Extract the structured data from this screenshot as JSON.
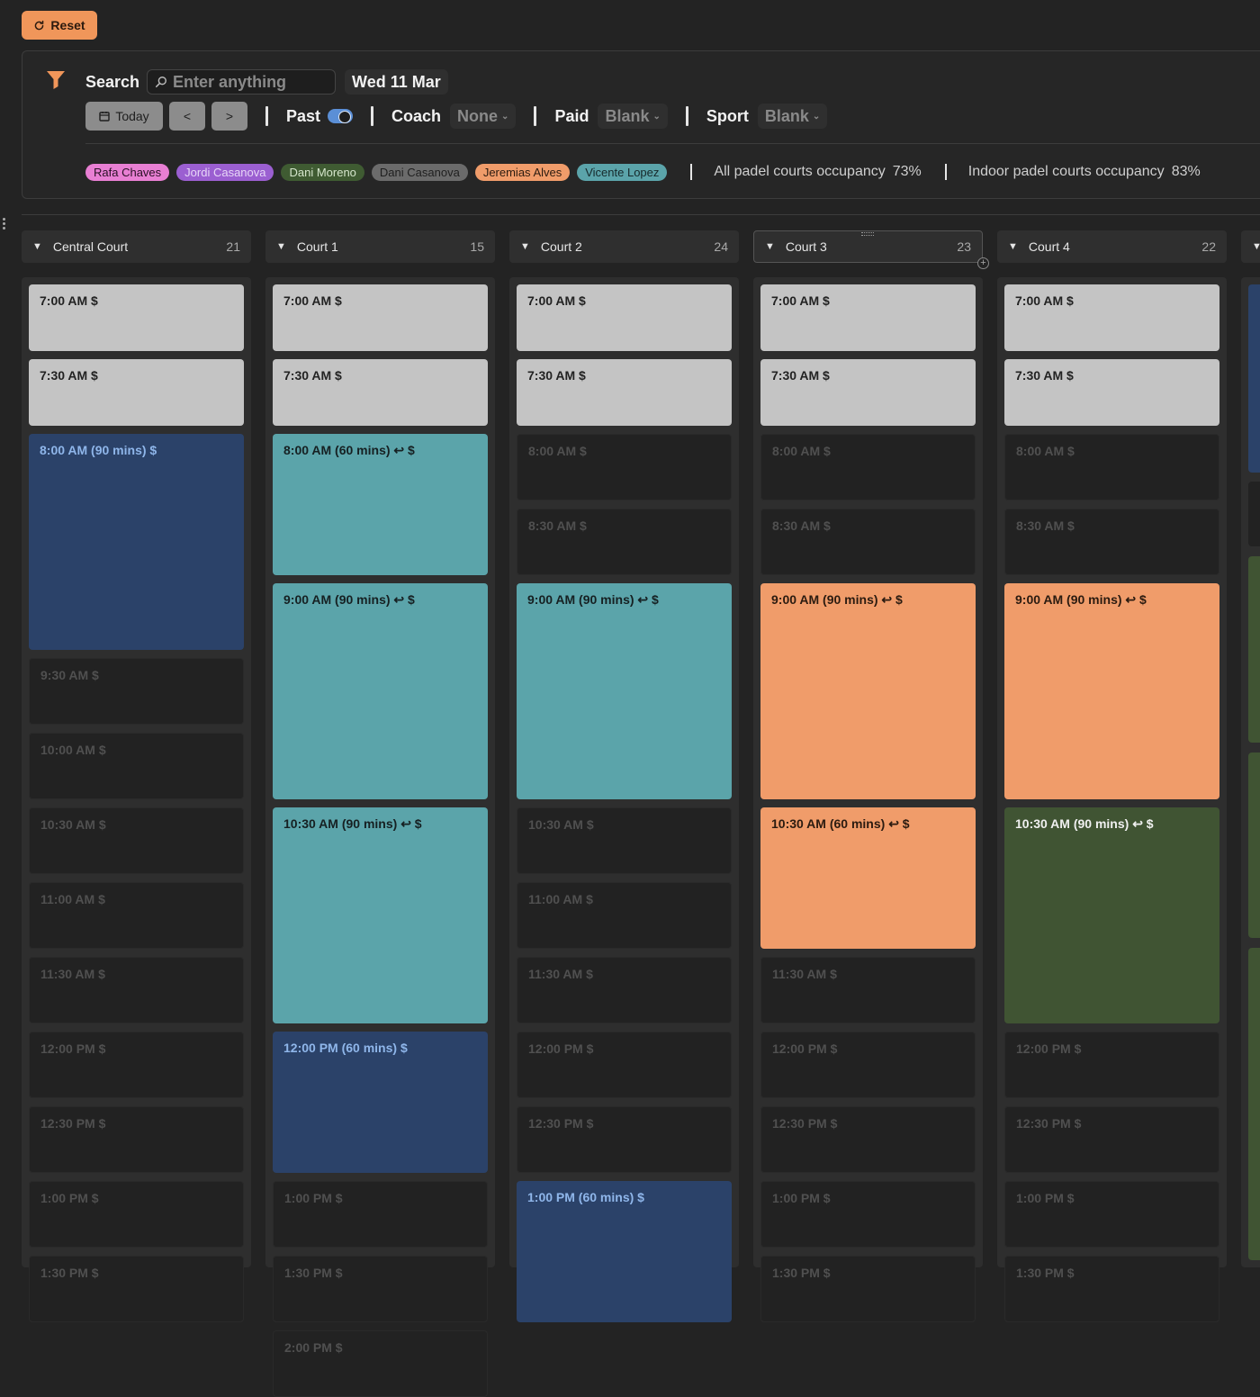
{
  "toolbar": {
    "reset_label": "Reset"
  },
  "filters": {
    "search_label": "Search",
    "search_placeholder": "Enter anything",
    "date": "Wed 11 Mar",
    "today_label": "Today",
    "prev_label": "<",
    "next_label": ">",
    "past_label": "Past",
    "past_enabled": true,
    "coach_label": "Coach",
    "coach_value": "None",
    "paid_label": "Paid",
    "paid_value": "Blank",
    "sport_label": "Sport",
    "sport_value": "Blank"
  },
  "coaches": [
    {
      "name": "Rafa Chaves",
      "bg": "#e87fd3",
      "fg": "#2a1126"
    },
    {
      "name": "Jordi Casanova",
      "bg": "#9b5fd1",
      "fg": "#e7d6f7"
    },
    {
      "name": "Dani Moreno",
      "bg": "#3f5b32",
      "fg": "#d5e6cc"
    },
    {
      "name": "Dani Casanova",
      "bg": "#6b6b6b",
      "fg": "#1f1f1f"
    },
    {
      "name": "Jeremias Alves",
      "bg": "#f09c6a",
      "fg": "#2b1b10"
    },
    {
      "name": "Vicente Lopez",
      "bg": "#5ba4aa",
      "fg": "#16292b"
    }
  ],
  "occupancy": [
    {
      "label": "All padel courts occupancy",
      "value": "73%"
    },
    {
      "label": "Indoor padel courts occupancy",
      "value": "83%"
    }
  ],
  "courts": [
    {
      "name": "Central Court",
      "count": "21",
      "slots": [
        {
          "label": "7:00 AM $",
          "kind": "light",
          "span": 1
        },
        {
          "label": "7:30 AM $",
          "kind": "light",
          "span": 1
        },
        {
          "label": "8:00 AM (90 mins) $",
          "kind": "blue",
          "span": 3
        },
        {
          "label": "9:30 AM $",
          "kind": "empty",
          "span": 1
        },
        {
          "label": "10:00 AM $",
          "kind": "empty",
          "span": 1
        },
        {
          "label": "10:30 AM $",
          "kind": "empty",
          "span": 1
        },
        {
          "label": "11:00 AM $",
          "kind": "empty",
          "span": 1
        },
        {
          "label": "11:30 AM $",
          "kind": "empty",
          "span": 1
        },
        {
          "label": "12:00 PM $",
          "kind": "empty",
          "span": 1
        },
        {
          "label": "12:30 PM $",
          "kind": "empty",
          "span": 1
        },
        {
          "label": "1:00 PM $",
          "kind": "empty",
          "span": 1
        },
        {
          "label": "1:30 PM $",
          "kind": "empty",
          "span": 1
        }
      ]
    },
    {
      "name": "Court 1",
      "count": "15",
      "slots": [
        {
          "label": "7:00 AM $",
          "kind": "light",
          "span": 1
        },
        {
          "label": "7:30 AM $",
          "kind": "light",
          "span": 1
        },
        {
          "label": "8:00 AM (60 mins) ↩ $",
          "kind": "teal",
          "span": 2
        },
        {
          "label": "9:00 AM (90 mins) ↩ $",
          "kind": "teal",
          "span": 3
        },
        {
          "label": "10:30 AM (90 mins) ↩ $",
          "kind": "teal",
          "span": 3
        },
        {
          "label": "12:00 PM (60 mins) $",
          "kind": "blue",
          "span": 2
        },
        {
          "label": "1:00 PM $",
          "kind": "empty",
          "span": 1
        },
        {
          "label": "1:30 PM $",
          "kind": "empty",
          "span": 1
        },
        {
          "label": "2:00 PM $",
          "kind": "empty",
          "span": 1
        }
      ]
    },
    {
      "name": "Court 2",
      "count": "24",
      "slots": [
        {
          "label": "7:00 AM $",
          "kind": "light",
          "span": 1
        },
        {
          "label": "7:30 AM $",
          "kind": "light",
          "span": 1
        },
        {
          "label": "8:00 AM $",
          "kind": "empty",
          "span": 1
        },
        {
          "label": "8:30 AM $",
          "kind": "empty",
          "span": 1
        },
        {
          "label": "9:00 AM (90 mins) ↩ $",
          "kind": "teal",
          "span": 3
        },
        {
          "label": "10:30 AM $",
          "kind": "empty",
          "span": 1
        },
        {
          "label": "11:00 AM $",
          "kind": "empty",
          "span": 1
        },
        {
          "label": "11:30 AM $",
          "kind": "empty",
          "span": 1
        },
        {
          "label": "12:00 PM $",
          "kind": "empty",
          "span": 1
        },
        {
          "label": "12:30 PM $",
          "kind": "empty",
          "span": 1
        },
        {
          "label": "1:00 PM (60 mins) $",
          "kind": "blue",
          "span": 2
        }
      ]
    },
    {
      "name": "Court 3",
      "count": "23",
      "slots": [
        {
          "label": "7:00 AM $",
          "kind": "light",
          "span": 1
        },
        {
          "label": "7:30 AM $",
          "kind": "light",
          "span": 1
        },
        {
          "label": "8:00 AM $",
          "kind": "empty",
          "span": 1
        },
        {
          "label": "8:30 AM $",
          "kind": "empty",
          "span": 1
        },
        {
          "label": "9:00 AM (90 mins) ↩ $",
          "kind": "orange",
          "span": 3
        },
        {
          "label": "10:30 AM (60 mins) ↩ $",
          "kind": "orange",
          "span": 2
        },
        {
          "label": "11:30 AM $",
          "kind": "empty",
          "span": 1
        },
        {
          "label": "12:00 PM $",
          "kind": "empty",
          "span": 1
        },
        {
          "label": "12:30 PM $",
          "kind": "empty",
          "span": 1
        },
        {
          "label": "1:00 PM $",
          "kind": "empty",
          "span": 1
        },
        {
          "label": "1:30 PM $",
          "kind": "empty",
          "span": 1
        }
      ]
    },
    {
      "name": "Court 4",
      "count": "22",
      "slots": [
        {
          "label": "7:00 AM $",
          "kind": "light",
          "span": 1
        },
        {
          "label": "7:30 AM $",
          "kind": "light",
          "span": 1
        },
        {
          "label": "8:00 AM $",
          "kind": "empty",
          "span": 1
        },
        {
          "label": "8:30 AM $",
          "kind": "empty",
          "span": 1
        },
        {
          "label": "9:00 AM (90 mins) ↩ $",
          "kind": "orange",
          "span": 3
        },
        {
          "label": "10:30 AM (90 mins) ↩ $",
          "kind": "green",
          "span": 3
        },
        {
          "label": "12:00 PM $",
          "kind": "empty",
          "span": 1
        },
        {
          "label": "12:30 PM $",
          "kind": "empty",
          "span": 1
        },
        {
          "label": "1:00 PM $",
          "kind": "empty",
          "span": 1
        },
        {
          "label": "1:30 PM $",
          "kind": "empty",
          "span": 1
        }
      ]
    }
  ]
}
